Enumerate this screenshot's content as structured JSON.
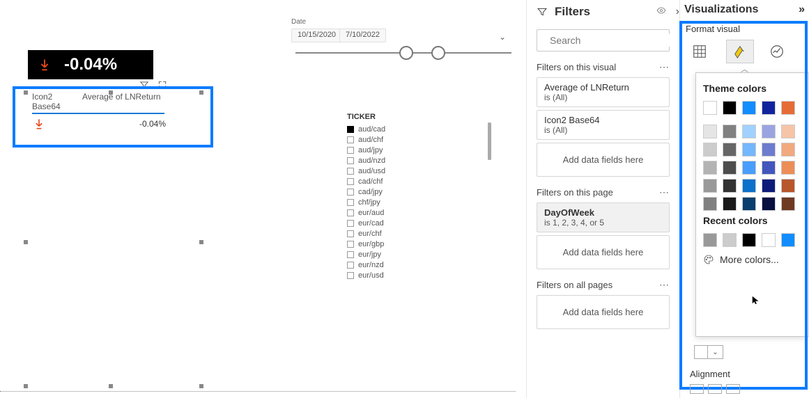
{
  "date_slicer": {
    "label": "Date",
    "start": "10/15/2020",
    "end": "7/10/2022"
  },
  "card": {
    "value": "-0.04%"
  },
  "table": {
    "col1": "Icon2 Base64",
    "col2": "Average of LNReturn",
    "row_value": "-0.04%"
  },
  "ticker": {
    "title": "TICKER",
    "items": [
      {
        "label": "aud/cad",
        "filled": true
      },
      {
        "label": "aud/chf",
        "filled": false
      },
      {
        "label": "aud/jpy",
        "filled": false
      },
      {
        "label": "aud/nzd",
        "filled": false
      },
      {
        "label": "aud/usd",
        "filled": false
      },
      {
        "label": "cad/chf",
        "filled": false
      },
      {
        "label": "cad/jpy",
        "filled": false
      },
      {
        "label": "chf/jpy",
        "filled": false
      },
      {
        "label": "eur/aud",
        "filled": false
      },
      {
        "label": "eur/cad",
        "filled": false
      },
      {
        "label": "eur/chf",
        "filled": false
      },
      {
        "label": "eur/gbp",
        "filled": false
      },
      {
        "label": "eur/jpy",
        "filled": false
      },
      {
        "label": "eur/nzd",
        "filled": false
      },
      {
        "label": "eur/usd",
        "filled": false
      }
    ]
  },
  "filters": {
    "title": "Filters",
    "search_placeholder": "Search",
    "section_visual": "Filters on this visual",
    "f1_name": "Average of LNReturn",
    "f1_state": "is (All)",
    "f2_name": "Icon2 Base64",
    "f2_state": "is (All)",
    "add_here": "Add data fields here",
    "section_page": "Filters on this page",
    "f3_name": "DayOfWeek",
    "f3_state": "is 1, 2, 3, 4, or 5",
    "section_all": "Filters on all pages"
  },
  "viz": {
    "title": "Visualizations",
    "format": "Format visual",
    "theme": "Theme colors",
    "recent": "Recent colors",
    "more": "More colors...",
    "alignment": "Alignment",
    "theme_colors": {
      "row1": [
        "#ffffff",
        "#000000",
        "#118dff",
        "#12239e",
        "#e66c37"
      ],
      "row2": [
        "#e5e5e5",
        "#808080",
        "#a0d1ff",
        "#9aa4e0",
        "#f6c4a7"
      ],
      "row3": [
        "#cccccc",
        "#666666",
        "#73b7ff",
        "#6d7cce",
        "#f1a97f"
      ],
      "row4": [
        "#b3b3b3",
        "#4d4d4d",
        "#479eff",
        "#4256bd",
        "#ec8e58"
      ],
      "row5": [
        "#999999",
        "#333333",
        "#0b71cc",
        "#0e1b7a",
        "#b8562c"
      ],
      "row6": [
        "#808080",
        "#1a1a1a",
        "#0a3e6e",
        "#071040",
        "#6e3a22"
      ]
    },
    "recent_colors": [
      "#999999",
      "#cccccc",
      "#000000",
      "#ffffff",
      "#118dff"
    ]
  }
}
